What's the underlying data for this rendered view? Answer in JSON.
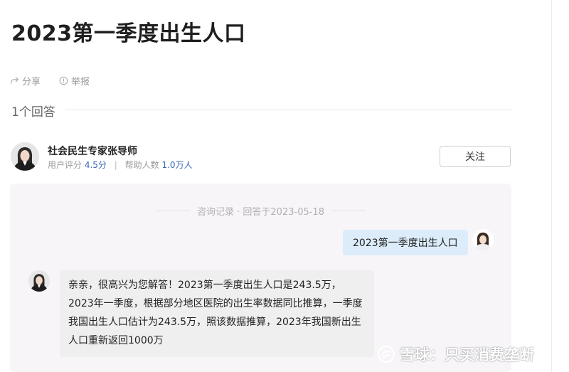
{
  "page": {
    "title": "2023第一季度出生人口"
  },
  "actions": {
    "share_label": "分享",
    "report_label": "举报"
  },
  "answers": {
    "count_label": "1个回答"
  },
  "expert": {
    "name": "社会民生专家张导师",
    "rating_label": "用户评分",
    "rating_value": "4.5分",
    "helped_label": "帮助人数",
    "helped_value": "1.0万人",
    "follow_label": "关注"
  },
  "chat": {
    "record_label": "咨询记录 · 回答于2023-05-18",
    "question": "2023第一季度出生人口",
    "answer": "亲亲，很高兴为您解答！2023第一季度出生人口是243.5万，2023年一季度，根据部分地区医院的出生率数据同比推算，一季度我国出生人口估计为243.5万，照该数据推算，2023年我国新出生人口重新返回1000万"
  },
  "watermark": {
    "text": "雪球：只买消费垄断"
  },
  "icons": {
    "share": "share-icon",
    "report": "report-icon",
    "snowball": "snowball-logo-icon"
  },
  "colors": {
    "question_bubble": "#dcecfa",
    "answer_bubble": "#efefef",
    "link_blue": "#3a67b6",
    "panel": "#f7f5f8"
  }
}
